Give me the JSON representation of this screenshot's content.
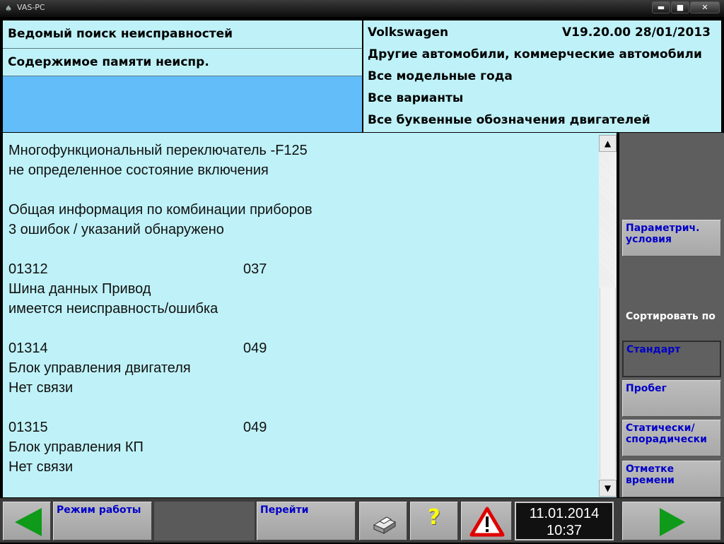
{
  "window": {
    "title": "VAS-PC",
    "min": "▬",
    "max": "■",
    "close": "✕"
  },
  "header_left": {
    "line1": "Ведомый поиск неисправностей",
    "line2": "Содержимое памяти неиспр."
  },
  "header_right": {
    "make": "Volkswagen",
    "version": "V19.20.00 28/01/2013",
    "line2": "Другие автомобили, коммерческие автомобили",
    "line3": "Все модельные года",
    "line4": "Все варианты",
    "line5": "Все буквенные обозначения двигателей"
  },
  "entries": [
    {
      "kind": "text",
      "text": "Многофункциональный переключатель -F125"
    },
    {
      "kind": "text",
      "text": "не определенное состояние включения"
    },
    {
      "kind": "text",
      "text": "Общая информация по комбинации приборов"
    },
    {
      "kind": "text",
      "text": "3 ошибок / указаний обнаружено"
    },
    {
      "kind": "code",
      "code": "01312",
      "value": "037"
    },
    {
      "kind": "text",
      "text": "Шина данных Привод"
    },
    {
      "kind": "text",
      "text": "имеется неисправность/ошибка"
    },
    {
      "kind": "code",
      "code": "01314",
      "value": "049"
    },
    {
      "kind": "text",
      "text": "Блок управления двигателя"
    },
    {
      "kind": "text",
      "text": "Нет связи"
    },
    {
      "kind": "code",
      "code": "01315",
      "value": "049"
    },
    {
      "kind": "text",
      "text": "Блок управления КП"
    },
    {
      "kind": "text",
      "text": "Нет связи"
    }
  ],
  "right_panel": {
    "param_button": "Параметрич. условия",
    "sort_label": "Сортировать по",
    "sort_standard": "Стандарт",
    "sort_mileage": "Пробег",
    "sort_static": "Статически/спорадически",
    "sort_time": "Отметке времени"
  },
  "toolbar": {
    "mode_label": "Режим работы",
    "goto_label": "Перейти",
    "help_glyph": "?",
    "date": "11.01.2014",
    "time": "10:37"
  },
  "colors": {
    "panel": "#bff2f8",
    "accent_blue": "#62bdf9",
    "button_text": "#0000c8",
    "arrow_green": "#0f9a1a"
  }
}
